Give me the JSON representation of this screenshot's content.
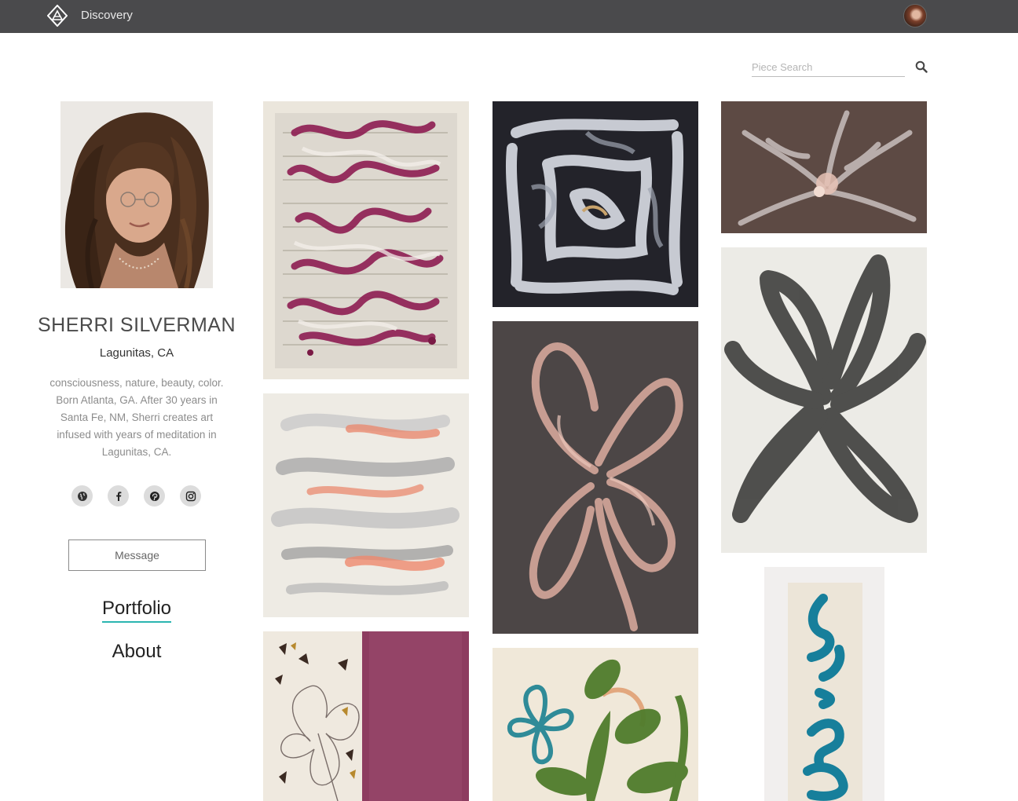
{
  "header": {
    "logo_icon": "artsy-logo-icon",
    "nav_label": "Discovery",
    "avatar_icon": "user-avatar"
  },
  "search": {
    "placeholder": "Piece Search",
    "value": "",
    "icon": "search-icon"
  },
  "artist": {
    "name": "SHERRI SILVERMAN",
    "location": "Lagunitas, CA",
    "bio": "consciousness, nature, beauty, color. Born Atlanta, GA. After 30 years in Santa Fe, NM, Sherri creates art infused with years of meditation in Lagunitas, CA."
  },
  "social": [
    {
      "icon": "globe-icon"
    },
    {
      "icon": "facebook-icon"
    },
    {
      "icon": "pinterest-icon"
    },
    {
      "icon": "instagram-icon"
    }
  ],
  "actions": {
    "message_label": "Message"
  },
  "profile_nav": {
    "portfolio_label": "Portfolio",
    "about_label": "About",
    "active": "Portfolio"
  },
  "colors": {
    "topbar": "#4a4a4c",
    "accent": "#2bb5b0"
  }
}
